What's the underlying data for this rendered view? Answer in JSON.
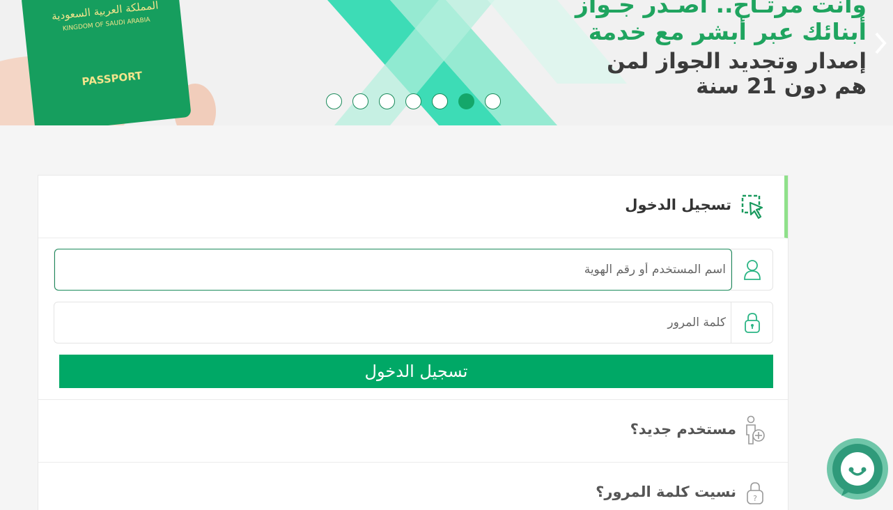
{
  "banner": {
    "lines": [
      "وانت مرتـاح.. أصـدر جـواز",
      "أبنائك عبر أبشر مع خدمة",
      "إصدار وتجديد الجواز لمن",
      "هم دون 21 سنة"
    ],
    "passport": {
      "arabic": "المملكة العربية السعودية",
      "kingdom": "KINGDOM OF SAUDI ARABIA",
      "label": "PASSPORT"
    },
    "dots_count": 7,
    "active_dot": 6
  },
  "login": {
    "title": "تسجيل الدخول",
    "username_placeholder": "اسم المستخدم أو رقم الهوية",
    "password_placeholder": "كلمة المرور",
    "submit_label": "تسجيل الدخول"
  },
  "links": {
    "new_user": "مستخدم جديد؟",
    "forgot_password": "نسيت كلمة المرور؟"
  },
  "colors": {
    "primary": "#00a866",
    "banner_green": "#1fa45f",
    "accent_bar": "#8fe08a",
    "chat": "#3ba88a"
  }
}
